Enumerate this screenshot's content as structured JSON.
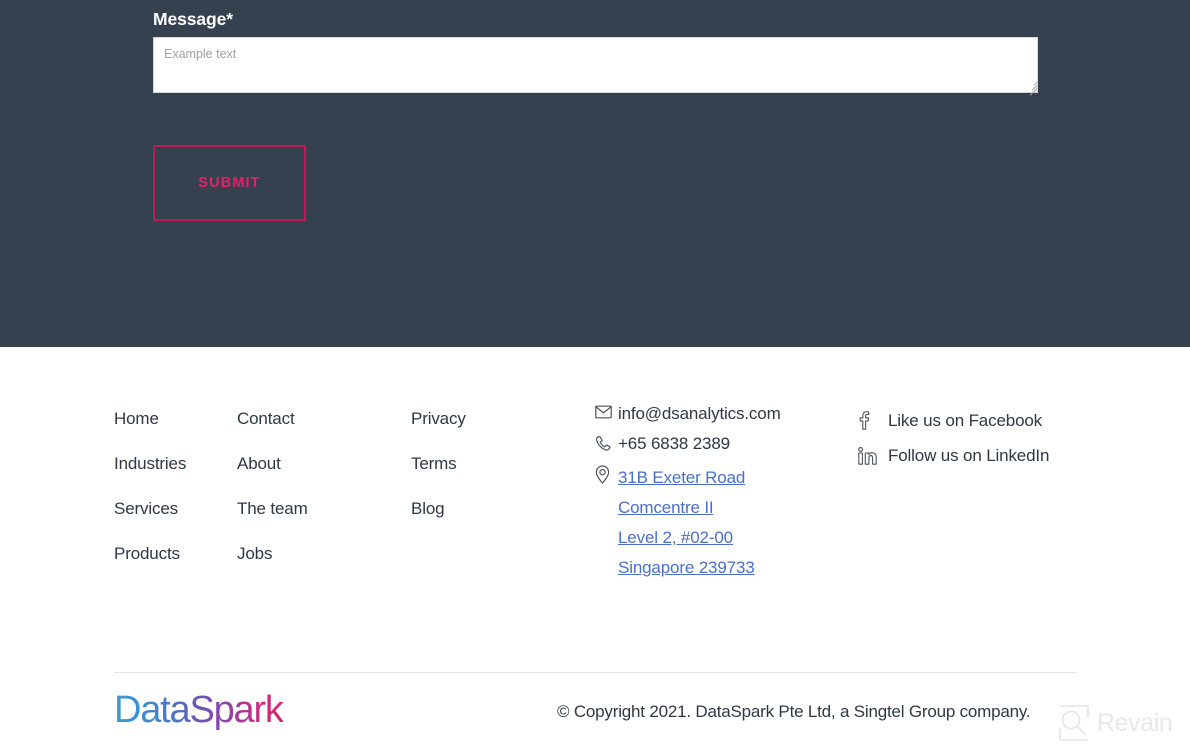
{
  "form": {
    "label": "Message*",
    "textarea_placeholder": "Example text",
    "textarea_value": "",
    "submit_label": "SUBMIT",
    "background_color": "#364150",
    "accent_color": "#e0216b"
  },
  "footer": {
    "nav_columns": [
      {
        "links": [
          "Home",
          "Industries",
          "Services",
          "Products"
        ]
      },
      {
        "links": [
          "Contact",
          "About",
          "The team",
          "Jobs"
        ]
      },
      {
        "links": [
          "Privacy",
          "Terms",
          "Blog"
        ]
      }
    ],
    "contact": {
      "email": "info@dsanalytics.com",
      "phone": "+65 6838 2389",
      "address_lines": [
        "31B Exeter Road",
        "Comcentre II",
        "Level 2, #02-00",
        "Singapore 239733"
      ],
      "email_icon": "envelope-icon",
      "phone_icon": "phone-icon",
      "address_icon": "map-pin-icon",
      "address_link_color": "#4a6fc9"
    },
    "social": [
      {
        "icon": "facebook-icon",
        "label": "Like us on Facebook"
      },
      {
        "icon": "linkedin-icon",
        "label": "Follow us on LinkedIn"
      }
    ],
    "brand": "DataSpark",
    "copyright": "© Copyright 2021. DataSpark Pte Ltd, a Singtel Group company."
  },
  "watermark": {
    "text": "Revain",
    "color": "#e6e8eb"
  }
}
